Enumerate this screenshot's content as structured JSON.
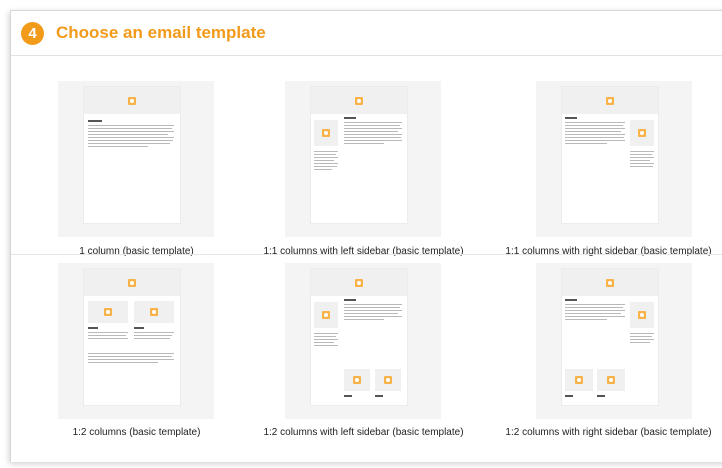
{
  "header": {
    "step_number": "4",
    "title": "Choose an email template"
  },
  "templates": [
    {
      "label": "1 column (basic template)"
    },
    {
      "label": "1:1 columns with left sidebar (basic template)"
    },
    {
      "label": "1:1 columns with right sidebar (basic template)"
    },
    {
      "label": "1:2 columns (basic template)"
    },
    {
      "label": "1:2 columns with left sidebar (basic template)"
    },
    {
      "label": "1:2 columns with right sidebar (basic template)"
    }
  ],
  "colors": {
    "accent": "#f29a1a",
    "thumbnail_background": "#f4f4f4"
  },
  "icons": {
    "image_placeholder": "image-placeholder-icon"
  }
}
